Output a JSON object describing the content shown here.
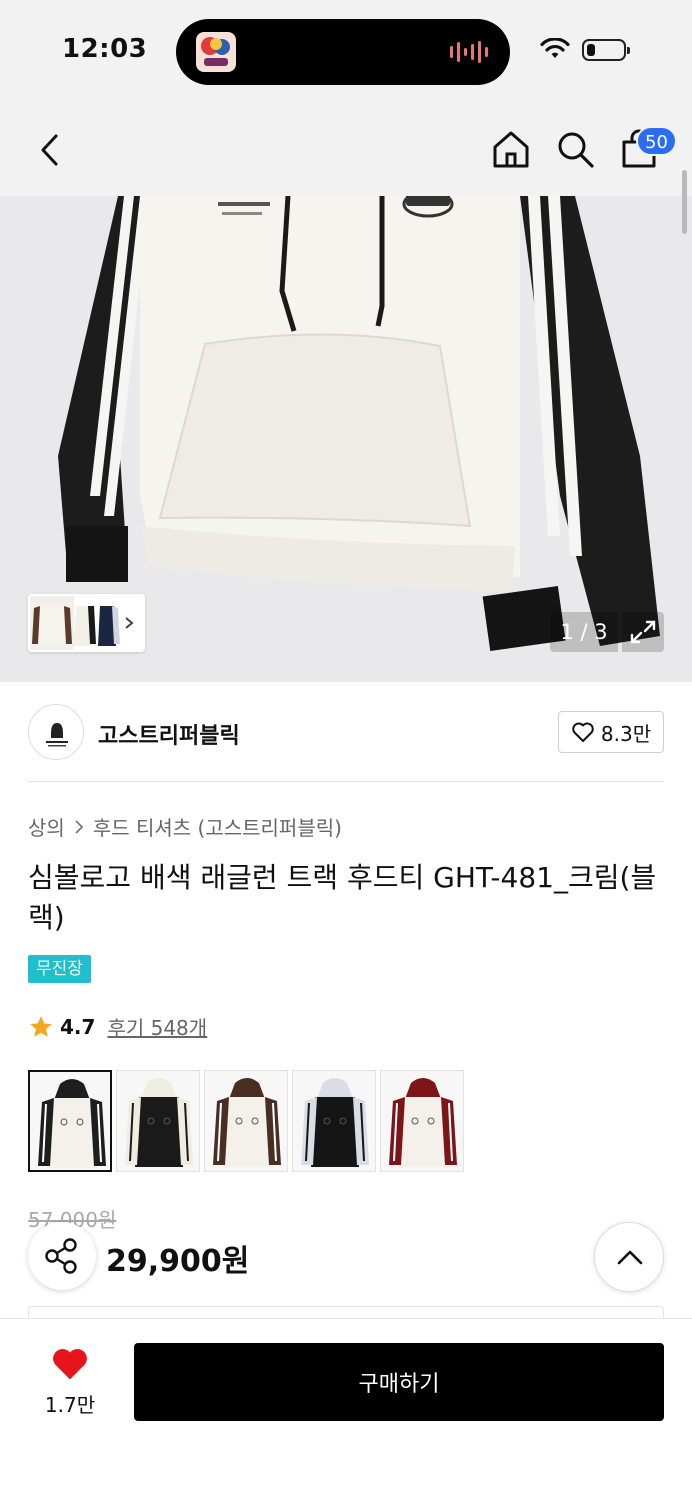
{
  "status_bar": {
    "time": "12:03"
  },
  "header": {
    "cart_count": "50"
  },
  "gallery": {
    "counter": "1 / 3"
  },
  "brand": {
    "name": "고스트리퍼블릭",
    "likes": "8.3만"
  },
  "breadcrumb": {
    "category": "상의",
    "subcategory": "후드 티셔츠 (고스트리퍼블릭)"
  },
  "product": {
    "title": "심볼로고 배색 래글런 트랙 후드티 GHT-481_크림(블랙)",
    "badge": "무진장",
    "rating": "4.7",
    "reviews": "후기 548개",
    "original_price": "57,000원",
    "price": "29,900원"
  },
  "swatches": [
    {
      "body": "#f3f1ea",
      "sleeve": "#1e1e1e",
      "stripe": "#ffffff"
    },
    {
      "body": "#1a1a1a",
      "sleeve": "#f0ece0",
      "stripe": "#1a1a1a"
    },
    {
      "body": "#f3f1ea",
      "sleeve": "#4b2e22",
      "stripe": "#ffffff"
    },
    {
      "body": "#151515",
      "sleeve": "#d8dde6",
      "stripe": "#151515"
    },
    {
      "body": "#f3f1ea",
      "sleeve": "#7d1418",
      "stripe": "#ffffff"
    }
  ],
  "bottom": {
    "favorite_count": "1.7만",
    "buy_label": "구매하기"
  },
  "colors": {
    "accent_blue": "#2b6cf6",
    "badge_teal": "#1fbfcf",
    "star": "#f5a623",
    "heart": "#e8141c"
  }
}
